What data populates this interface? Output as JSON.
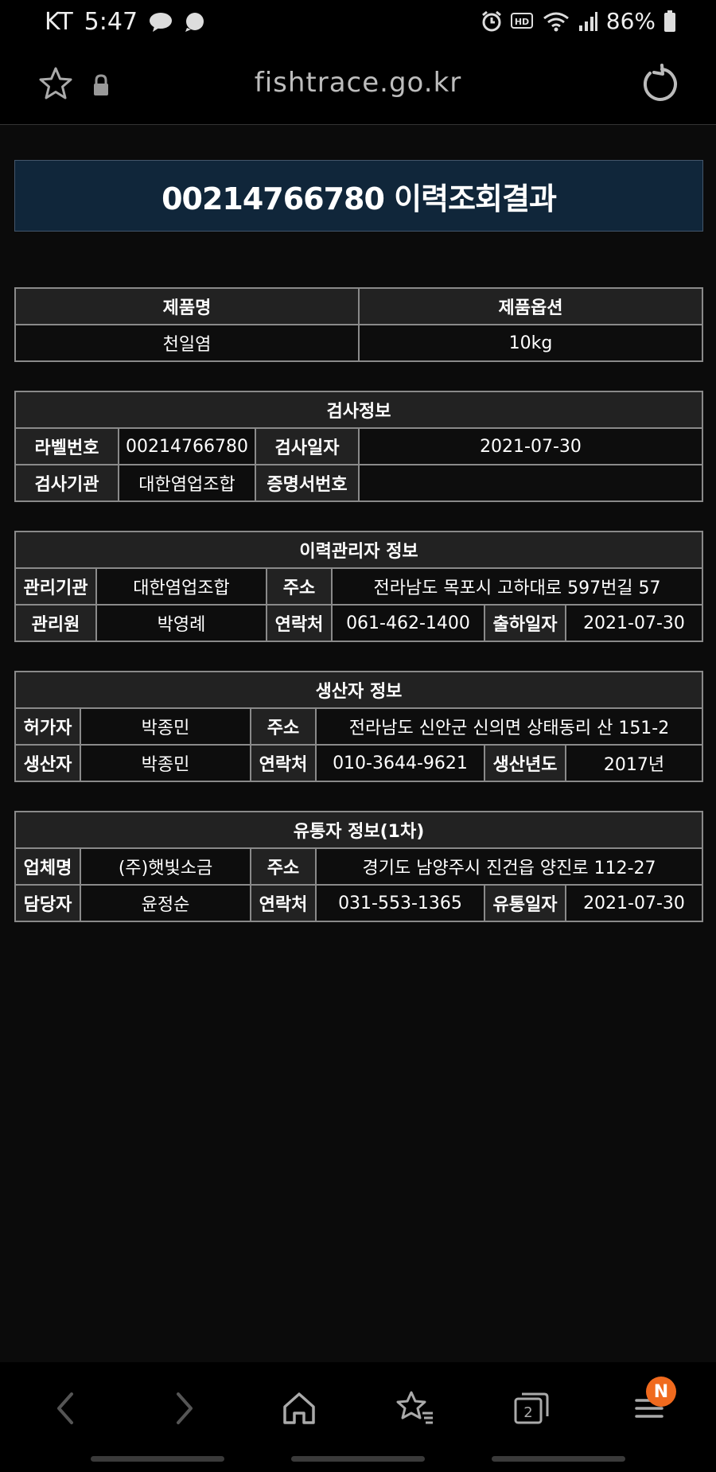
{
  "status_bar": {
    "carrier": "KT",
    "time": "5:47",
    "battery": "86%"
  },
  "browser": {
    "url": "fishtrace.go.kr"
  },
  "page": {
    "title": "00214766780 이력조회결과"
  },
  "product": {
    "headers": [
      "제품명",
      "제품옵션"
    ],
    "values": [
      "천일염",
      "10kg"
    ]
  },
  "inspection": {
    "title": "검사정보",
    "label_no_head": "라벨번호",
    "label_no": "00214766780",
    "date_head": "검사일자",
    "date": "2021-07-30",
    "agency_head": "검사기관",
    "agency": "대한염업조합",
    "cert_head": "증명서번호",
    "cert": ""
  },
  "manager": {
    "title": "이력관리자 정보",
    "org_head": "관리기관",
    "org": "대한염업조합",
    "addr_head": "주소",
    "addr": "전라남도 목포시 고하대로 597번길 57",
    "person_head": "관리원",
    "person": "박영례",
    "contact_head": "연락처",
    "contact": "061-462-1400",
    "ship_head": "출하일자",
    "ship": "2021-07-30"
  },
  "producer": {
    "title": "생산자 정보",
    "licensee_head": "허가자",
    "licensee": "박종민",
    "addr_head": "주소",
    "addr": "전라남도 신안군 신의면 상태동리 산 151-2",
    "producer_head": "생산자",
    "producer": "박종민",
    "contact_head": "연락처",
    "contact": "010-3644-9621",
    "year_head": "생산년도",
    "year": "2017년"
  },
  "distributor": {
    "title": "유통자 정보(1차)",
    "company_head": "업체명",
    "company": "(주)햇빛소금",
    "addr_head": "주소",
    "addr": "경기도 남양주시 진건읍 양진로 112-27",
    "person_head": "담당자",
    "person": "윤정순",
    "contact_head": "연락처",
    "contact": "031-553-1365",
    "date_head": "유통일자",
    "date": "2021-07-30"
  },
  "bottom_nav": {
    "tabs_count": "2",
    "badge": "N"
  }
}
